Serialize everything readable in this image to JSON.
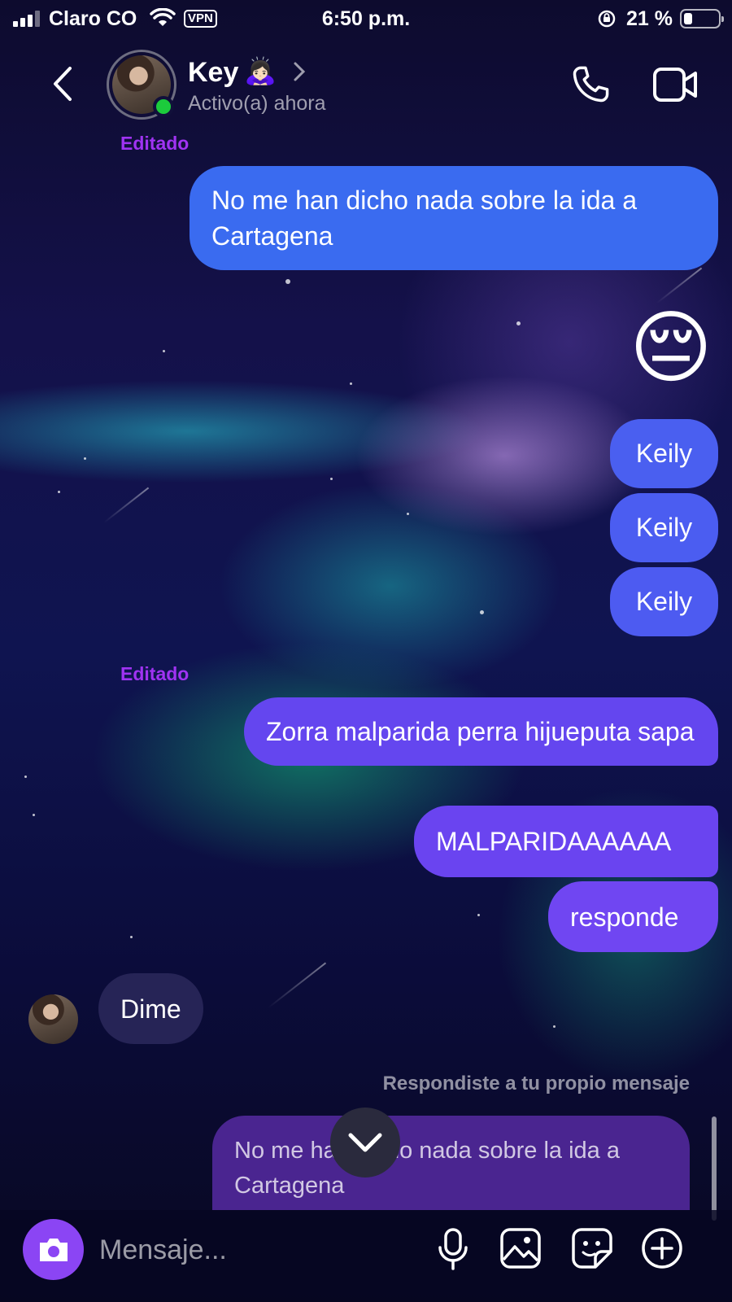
{
  "status_bar": {
    "carrier": "Claro CO",
    "vpn": "VPN",
    "time": "6:50 p.m.",
    "battery": "21 %",
    "battery_level": 0.21
  },
  "header": {
    "contact_name": "Key",
    "name_emoji": "🙇🏻‍♀️",
    "status": "Activo(a) ahora"
  },
  "edited_labels": [
    "Editado",
    "Editado"
  ],
  "messages": {
    "sent_1": "No me han dicho nada sobre la ida a Cartagena",
    "emoji": "😔",
    "keily": [
      "Keily",
      "Keily",
      "Keily"
    ],
    "sent_2": "Zorra malparida perra hijueputa sapa",
    "sent_3": "MALPARIDAAAAAA",
    "sent_4": "responde",
    "received_1": "Dime"
  },
  "reply": {
    "note": "Respondiste a tu propio mensaje",
    "quoted": "No me han dicho nada sobre la ida a Cartagena"
  },
  "composer": {
    "placeholder": "Mensaje..."
  },
  "icons": [
    "back-icon",
    "chevron-right-icon",
    "phone-icon",
    "video-icon",
    "chevron-down-icon",
    "camera-icon",
    "microphone-icon",
    "image-icon",
    "sticker-icon",
    "plus-circle-icon"
  ],
  "colors": {
    "sent_blue": "#3a6bf0",
    "sent_purple": "#6a44f0",
    "received": "#262456",
    "edited": "#a033f2",
    "online": "#1ccb3c",
    "camera_button": "#8b45f4"
  }
}
